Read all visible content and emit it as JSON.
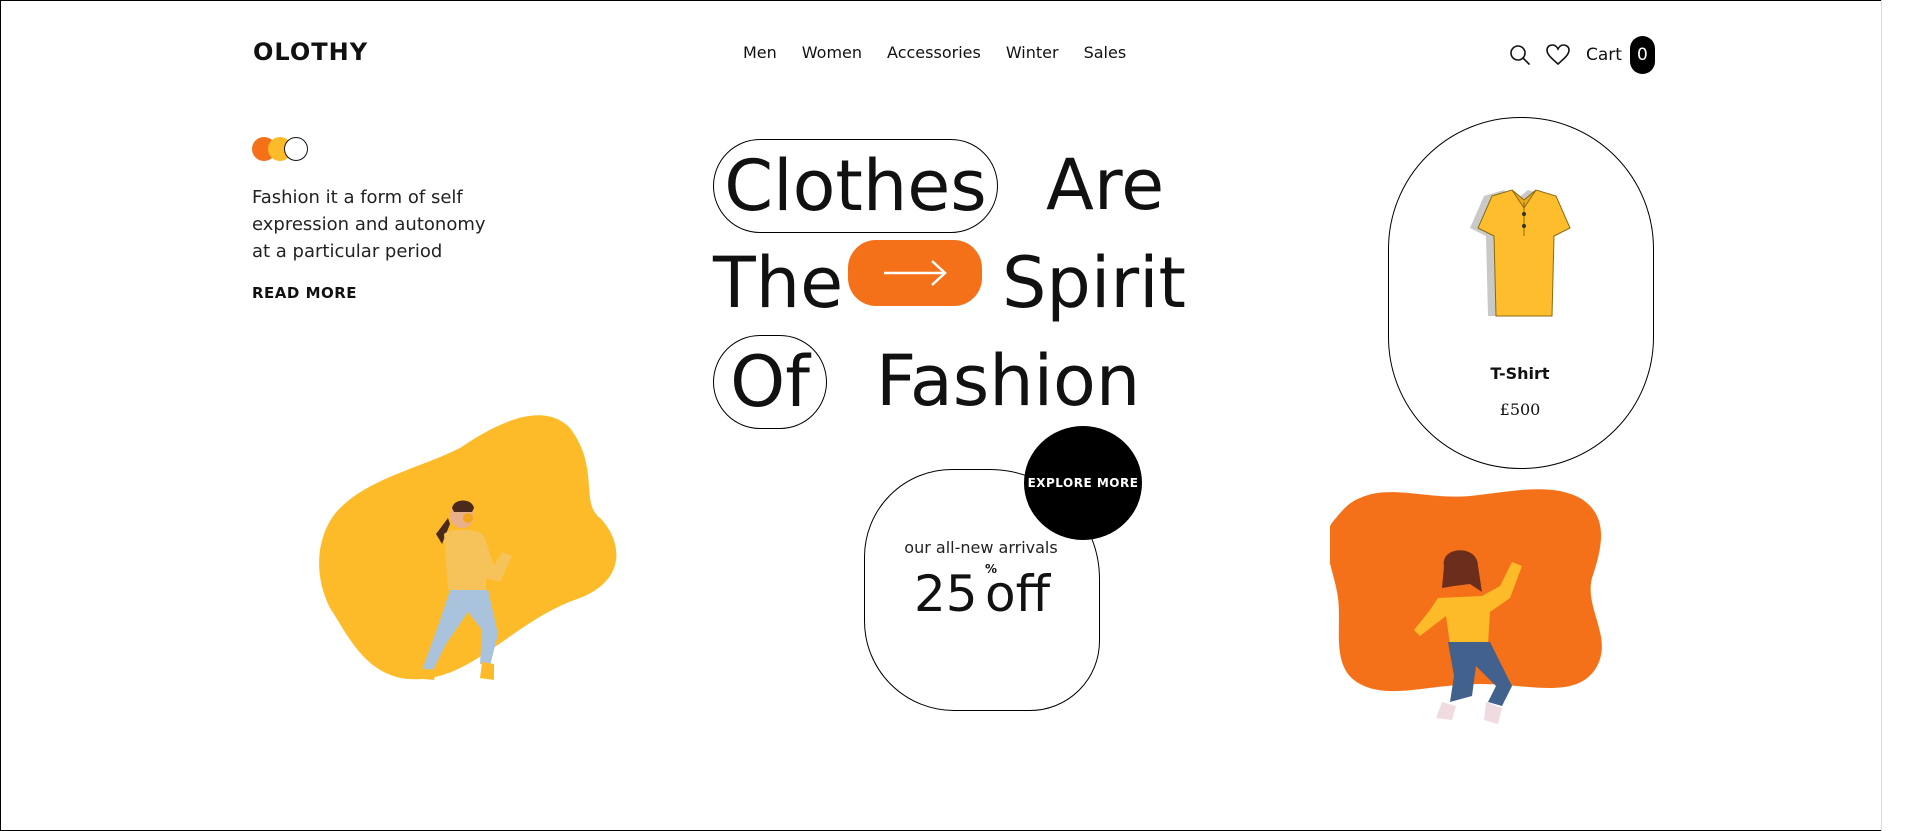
{
  "brand": {
    "logo": "OLOTHY"
  },
  "nav": {
    "items": [
      "Men",
      "Women",
      "Accessories",
      "Winter",
      "Sales"
    ]
  },
  "header": {
    "search_icon": "search-icon",
    "wishlist_icon": "heart-icon",
    "cart_label": "Cart",
    "cart_count": "0"
  },
  "intro": {
    "text": "Fashion it a form of self expression and autonomy at a particular period",
    "read_more": "READ MORE",
    "dot_colors": [
      "#f57119",
      "#fdbb2a",
      "#ffffff"
    ]
  },
  "headline": {
    "word1": "Clothes",
    "word2": "Are",
    "word3": "The",
    "word4": "Spirit",
    "word5": "Of",
    "word6": "Fashion",
    "arrow_icon": "arrow-right-icon"
  },
  "product": {
    "name": "T-Shirt",
    "price": "£500",
    "image": "yellow-polo-shirt"
  },
  "promo": {
    "subtitle": "our all-new arrivals",
    "value": "25",
    "percent": "%",
    "suffix": "off",
    "explore_label": "EXPLORE MORE"
  },
  "colors": {
    "accent_orange": "#f57119",
    "accent_yellow": "#fdbb2a",
    "ink": "#000000"
  }
}
